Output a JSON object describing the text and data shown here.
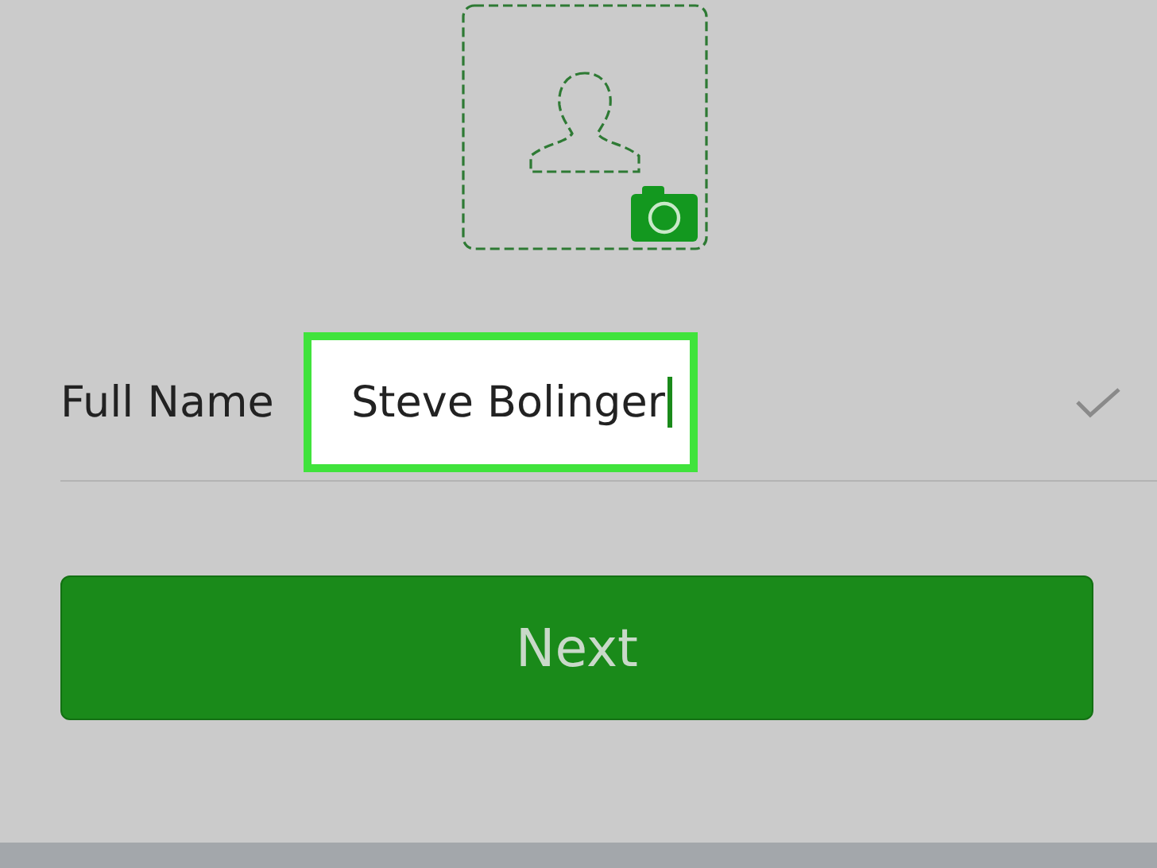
{
  "profile_photo": {
    "kind": "picture-placeholder"
  },
  "full_name": {
    "label": "Full Name",
    "value": "Steve Bolinger",
    "focused": true
  },
  "next_button": {
    "label": "Next"
  }
}
